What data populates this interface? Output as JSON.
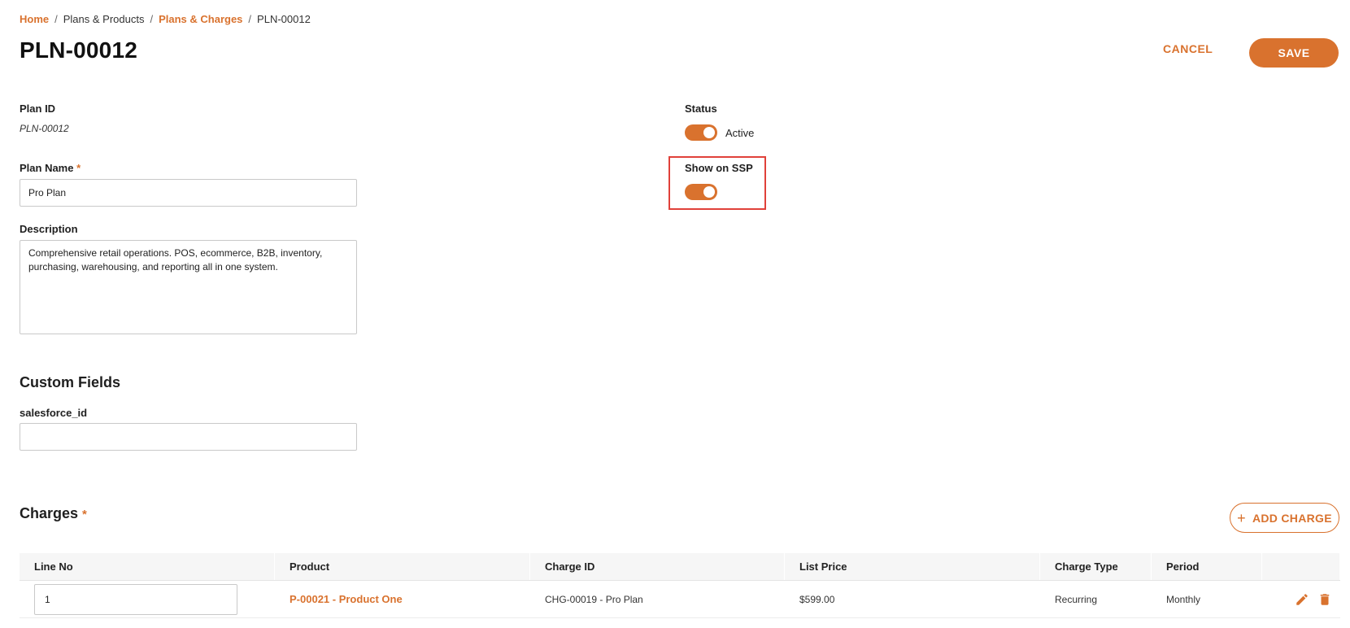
{
  "breadcrumb": {
    "home": "Home",
    "plans_products": "Plans & Products",
    "plans_charges": "Plans & Charges",
    "current": "PLN-00012",
    "separator": "/"
  },
  "header": {
    "title": "PLN-00012",
    "cancel_label": "CANCEL",
    "save_label": "SAVE"
  },
  "form": {
    "plan_id_label": "Plan ID",
    "plan_id_value": "PLN-00012",
    "plan_name_label": "Plan Name",
    "required_mark": "*",
    "plan_name_value": "Pro Plan",
    "description_label": "Description",
    "description_value": "Comprehensive retail operations. POS, ecommerce, B2B, inventory, purchasing, warehousing, and reporting all in one system.",
    "status_label": "Status",
    "status_value": "Active",
    "status_on": true,
    "show_on_ssp_label": "Show on SSP",
    "show_on_ssp_on": true
  },
  "custom_fields": {
    "title": "Custom Fields",
    "salesforce_id_label": "salesforce_id",
    "salesforce_id_value": ""
  },
  "charges": {
    "title": "Charges",
    "add_label": "ADD CHARGE",
    "columns": [
      "Line No",
      "Product",
      "Charge ID",
      "List Price",
      "Charge Type",
      "Period"
    ],
    "rows": [
      {
        "line_no": "1",
        "product": "P-00021 - Product One",
        "charge_id": "CHG-00019 - Pro Plan",
        "list_price": "$599.00",
        "charge_type": "Recurring",
        "period": "Monthly"
      }
    ]
  },
  "colors": {
    "accent": "#d9722e",
    "highlight": "#e0413a"
  },
  "icons": {
    "edit": "pencil-icon",
    "delete": "trash-icon",
    "add": "plus-icon"
  }
}
